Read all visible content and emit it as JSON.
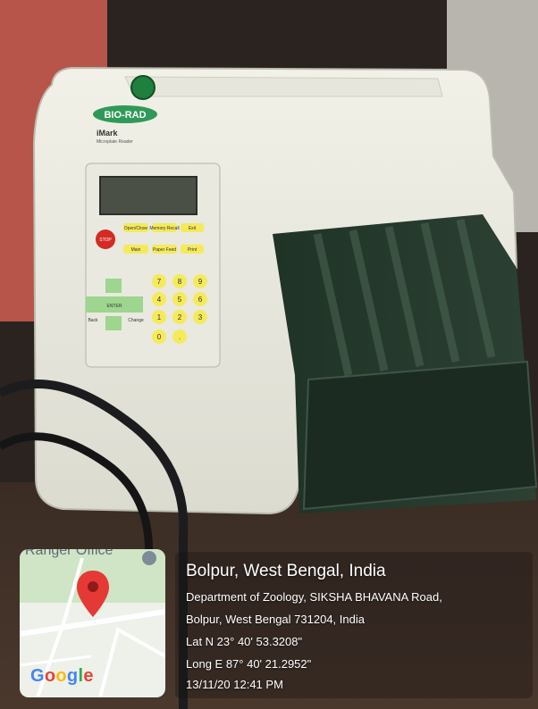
{
  "device": {
    "brand": "BIO-RAD",
    "model": "iMark",
    "model_sub": "Microplate Reader",
    "keypad": {
      "top_row": [
        "Open/Close",
        "Memory Recall",
        "Exit"
      ],
      "second_row": [
        "Main",
        "Paper Feed",
        "Print"
      ],
      "numbers": [
        "7",
        "8",
        "9",
        "4",
        "5",
        "6",
        "1",
        "2",
        "3",
        "0",
        "."
      ],
      "nav": [
        "Back",
        "ENTER",
        "Change"
      ],
      "stop": "STOP"
    }
  },
  "map": {
    "place_label": "Ranger Office",
    "logo": "Google",
    "pin_color": "#e53935"
  },
  "geotag": {
    "title": "Bolpur, West Bengal, India",
    "address_line1": "Department of Zoology, SIKSHA BHAVANA Road,",
    "address_line2": "Bolpur, West Bengal 731204, India",
    "latitude": "Lat N 23° 40' 53.3208\"",
    "longitude": "Long E 87° 40' 21.2952\"",
    "timestamp": "13/11/20 12:41 PM"
  }
}
